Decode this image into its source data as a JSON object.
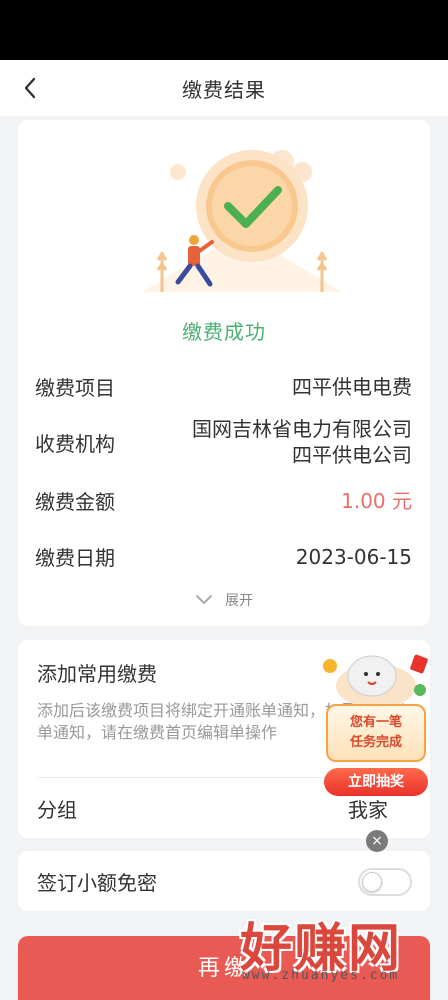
{
  "header": {
    "title": "缴费结果"
  },
  "result": {
    "status_text": "缴费成功",
    "rows": [
      {
        "label": "缴费项目",
        "value": "四平供电电费"
      },
      {
        "label": "收费机构",
        "value_line1": "国网吉林省电力有限公司",
        "value_line2": "四平供电公司"
      },
      {
        "label": "缴费金额",
        "value": "1.00 元"
      },
      {
        "label": "缴费日期",
        "value": "2023-06-15"
      }
    ],
    "expand_label": "展开"
  },
  "favorite": {
    "title": "添加常用缴费",
    "description": "添加后该缴费项目将绑定开通账单通知，如需关闭账单通知，请在缴费首页编辑单操作",
    "group_label": "分组",
    "group_value": "我家"
  },
  "sign": {
    "label": "签订小额免密",
    "toggle_on": false
  },
  "bottom_button": {
    "label": "再缴"
  },
  "task_widget": {
    "bubble_line1": "您有一笔",
    "bubble_line2": "任务完成",
    "button_label": "立即抽奖",
    "close_symbol": "×"
  },
  "watermark": {
    "brand": "好赚网",
    "url": "www.zhuanyes.com"
  },
  "colors": {
    "success": "#4caf73",
    "amount": "#e8706a",
    "primary_button": "#ea5a54"
  }
}
